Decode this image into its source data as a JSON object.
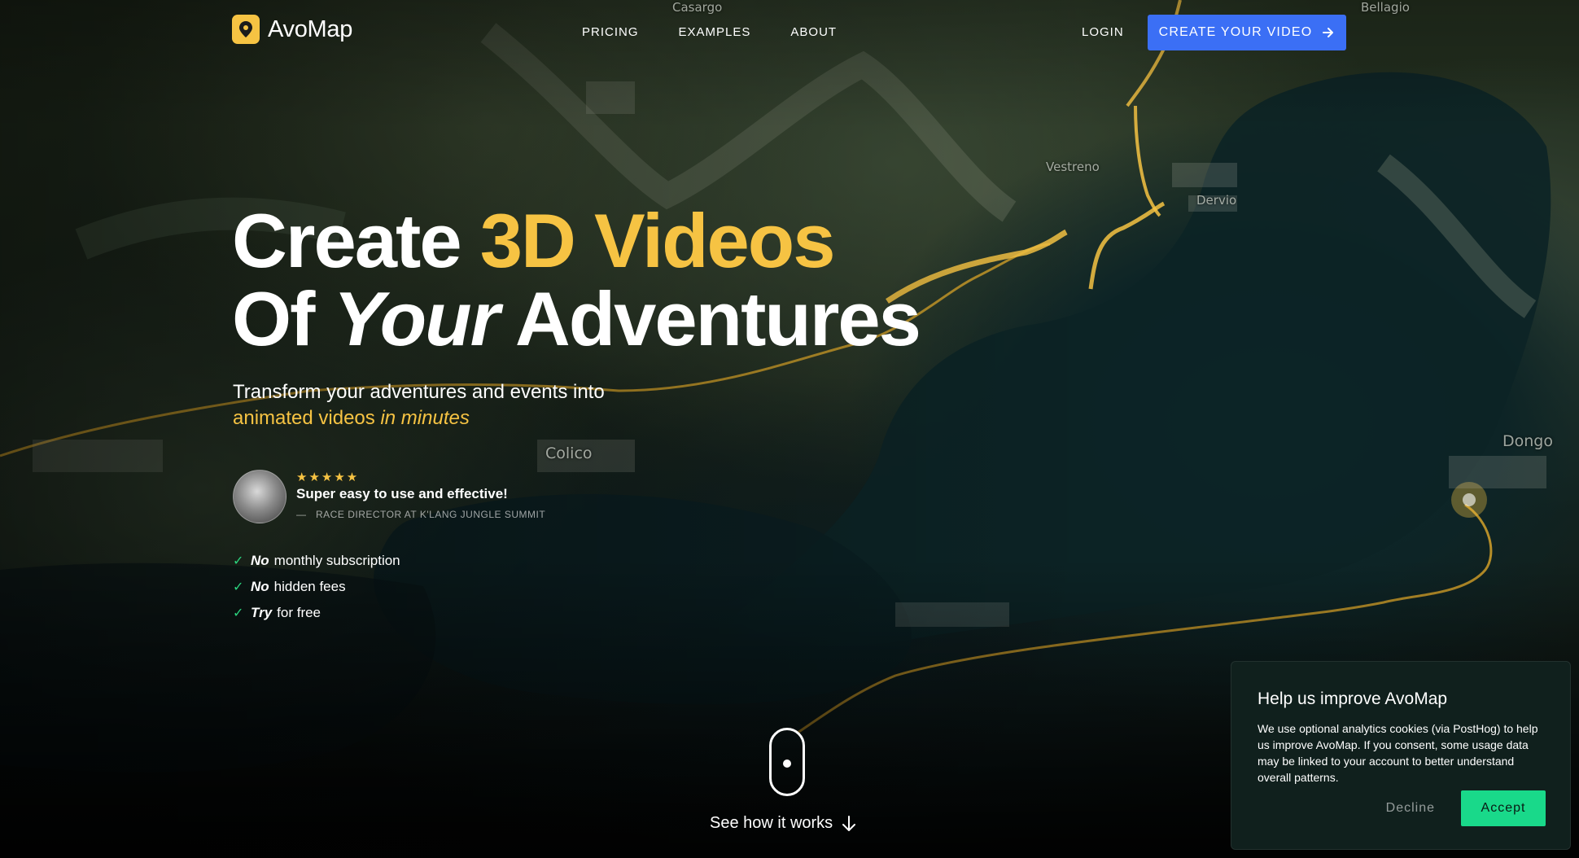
{
  "header": {
    "logo_text": "AvoMap",
    "nav": [
      "PRICING",
      "EXAMPLES",
      "ABOUT"
    ],
    "login": "LOGIN",
    "cta": "CREATE YOUR VIDEO"
  },
  "hero": {
    "line1_plain": "Create ",
    "line1_accent": "3D Videos",
    "line2_plain": "Of ",
    "line2_italic": "Your",
    "line2_rest": " Adventures",
    "subtitle_line1": "Transform your adventures and events into",
    "subtitle_line2": "animated videos ",
    "subtitle_line2_italic": "in minutes"
  },
  "testimonial": {
    "stars": "★★★★★",
    "quote": "Super easy to use and effective!",
    "author": "RACE DIRECTOR AT K'LANG JUNGLE SUMMIT"
  },
  "features": [
    {
      "em": "No",
      "text": "monthly subscription"
    },
    {
      "em": "No",
      "text": "hidden fees"
    },
    {
      "em": "Try",
      "text": "for free"
    }
  ],
  "scroll_hint": "See how it works",
  "map_labels": [
    "Casargo",
    "Bellagio",
    "Vestreno",
    "Dervio",
    "Colico",
    "Dongo"
  ],
  "cookie": {
    "title": "Help us improve AvoMap",
    "body": "We use optional analytics cookies (via PostHog) to help us improve AvoMap. If you consent, some usage data may be linked to your account to better understand overall patterns.",
    "decline": "Decline",
    "accept": "Accept"
  },
  "colors": {
    "accent": "#f6c343",
    "cta_blue": "#3b6ff5",
    "accept_green": "#19d98a"
  }
}
